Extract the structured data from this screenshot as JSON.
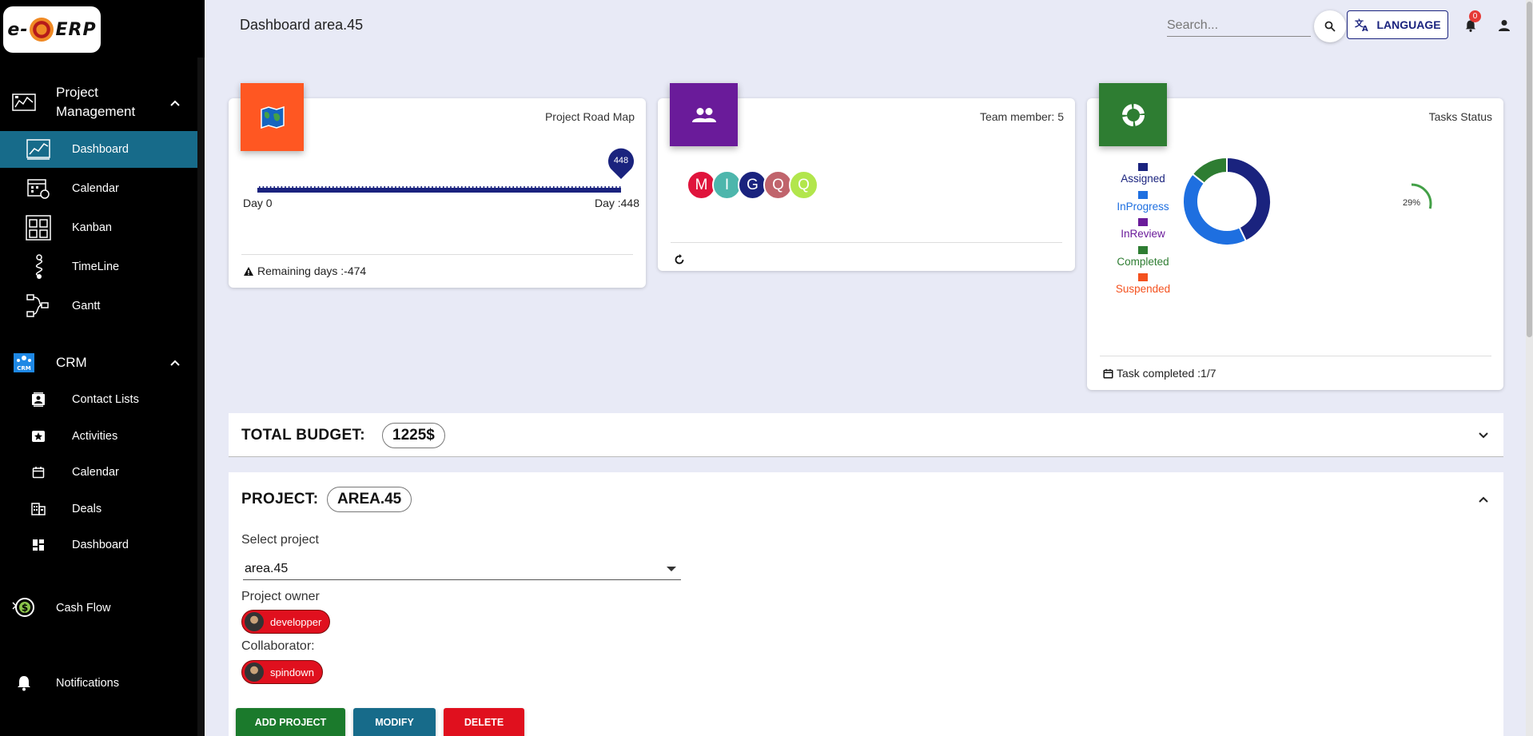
{
  "app": {
    "logo_text_left": "e-",
    "logo_text_right": "ERP"
  },
  "sidebar": {
    "project_management": {
      "label": "Project Management",
      "items": [
        {
          "label": "Dashboard",
          "icon": "chart-icon",
          "active": true
        },
        {
          "label": "Calendar",
          "icon": "calendar-grid-icon"
        },
        {
          "label": "Kanban",
          "icon": "kanban-icon"
        },
        {
          "label": "TimeLine",
          "icon": "timeline-icon"
        },
        {
          "label": "Gantt",
          "icon": "gantt-icon"
        }
      ]
    },
    "crm": {
      "label": "CRM",
      "icon_text": "CRM",
      "items": [
        {
          "label": "Contact Lists",
          "icon": "contact-icon"
        },
        {
          "label": "Activities",
          "icon": "activity-icon"
        },
        {
          "label": "Calendar",
          "icon": "calendar-icon"
        },
        {
          "label": "Deals",
          "icon": "deals-icon"
        },
        {
          "label": "Dashboard",
          "icon": "dashboard-icon"
        }
      ]
    },
    "cash_flow": {
      "label": "Cash Flow"
    },
    "notifications": {
      "label": "Notifications"
    }
  },
  "topbar": {
    "title": "Dashboard area.45",
    "search_placeholder": "Search...",
    "language_label": "LANGUAGE",
    "notification_count": "0"
  },
  "cards": {
    "roadmap": {
      "title": "Project Road Map",
      "start_label": "Day 0",
      "end_label": "Day :448",
      "marker_value": "448",
      "progress": 1.0,
      "footer": "Remaining days :-474",
      "badge_color": "#ff5722"
    },
    "team": {
      "title": "Team member: 5",
      "badge_color": "#6a1b9a",
      "members": [
        {
          "initial": "M",
          "color": "#e0143c"
        },
        {
          "initial": "I",
          "color": "#4db6ac"
        },
        {
          "initial": "G",
          "color": "#1a237e"
        },
        {
          "initial": "Q",
          "color": "#c0646c"
        },
        {
          "initial": "Q",
          "color": "#b2e64c"
        }
      ]
    },
    "tasks": {
      "title": "Tasks Status",
      "badge_color": "#2e7d32",
      "footer": "Task completed :1/7",
      "progress_label": "29%",
      "progress_value": 0.29,
      "legend": [
        {
          "label": "Assigned",
          "color": "#1a237e",
          "text_color": "#1a237e"
        },
        {
          "label": "InProgress",
          "color": "#1e6fe0",
          "text_color": "#1e6fe0"
        },
        {
          "label": "InReview",
          "color": "#6a1b9a",
          "text_color": "#6a1b9a"
        },
        {
          "label": "Completed",
          "color": "#2e7d32",
          "text_color": "#2e7d32"
        },
        {
          "label": "Suspended",
          "color": "#f4511e",
          "text_color": "#f4511e"
        }
      ]
    }
  },
  "chart_data": {
    "type": "pie",
    "categories": [
      "Assigned",
      "InProgress",
      "InReview",
      "Completed",
      "Suspended"
    ],
    "values": [
      3,
      3,
      0,
      1,
      0
    ]
  },
  "budget": {
    "label": "TOTAL BUDGET:",
    "value": "1225$"
  },
  "project": {
    "label": "PROJECT:",
    "value": "AREA.45",
    "select_label": "Select project",
    "select_value": "area.45",
    "owner_label": "Project owner",
    "owner": "developper",
    "collaborator_label": "Collaborator:",
    "collaborator": "spindown",
    "buttons": {
      "add": "ADD PROJECT",
      "modify": "MODIFY",
      "delete": "DELETE"
    }
  }
}
